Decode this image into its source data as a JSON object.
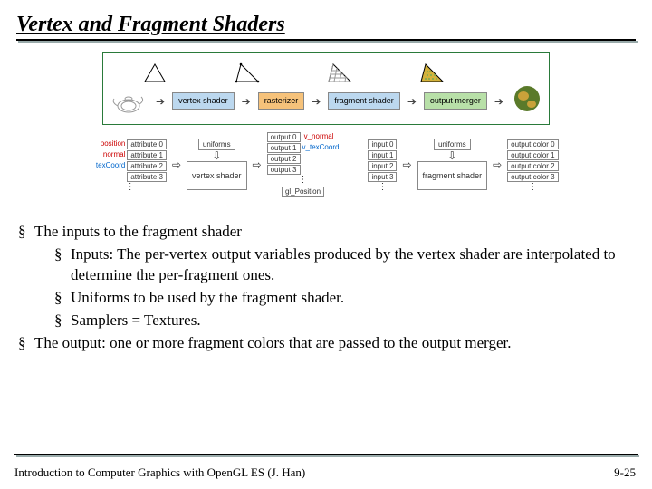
{
  "title": "Vertex and Fragment Shaders",
  "pipeline": {
    "stages": [
      "vertex\nshader",
      "rasterizer",
      "fragment\nshader",
      "output\nmerger"
    ]
  },
  "dataflow": {
    "uniforms_label": "uniforms",
    "vs": "vertex\nshader",
    "fs": "fragment\nshader",
    "vs_in_labels": [
      "position",
      "normal",
      "texCoord"
    ],
    "vs_in": [
      "attribute 0",
      "attribute 1",
      "attribute 2",
      "attribute 3"
    ],
    "vs_out": [
      "output 0",
      "output 1",
      "output 2",
      "output 3"
    ],
    "vs_out_labels": [
      "v_normal",
      "v_texCoord"
    ],
    "gl_position": "gl_Position",
    "fs_in": [
      "input 0",
      "input 1",
      "input 2",
      "input 3"
    ],
    "fs_out": [
      "output color 0",
      "output color 1",
      "output color 2",
      "output color 3"
    ]
  },
  "bullets": [
    {
      "text": "The inputs to the fragment shader",
      "children": [
        "Inputs: The per-vertex output variables produced by the vertex shader are interpolated to determine the per-fragment ones.",
        "Uniforms to be used by the fragment shader.",
        "Samplers = Textures."
      ]
    },
    {
      "text": "The output: one or more fragment colors that are passed to the output merger."
    }
  ],
  "footer": "Introduction to Computer Graphics with OpenGL ES (J. Han)",
  "page": "9-25"
}
